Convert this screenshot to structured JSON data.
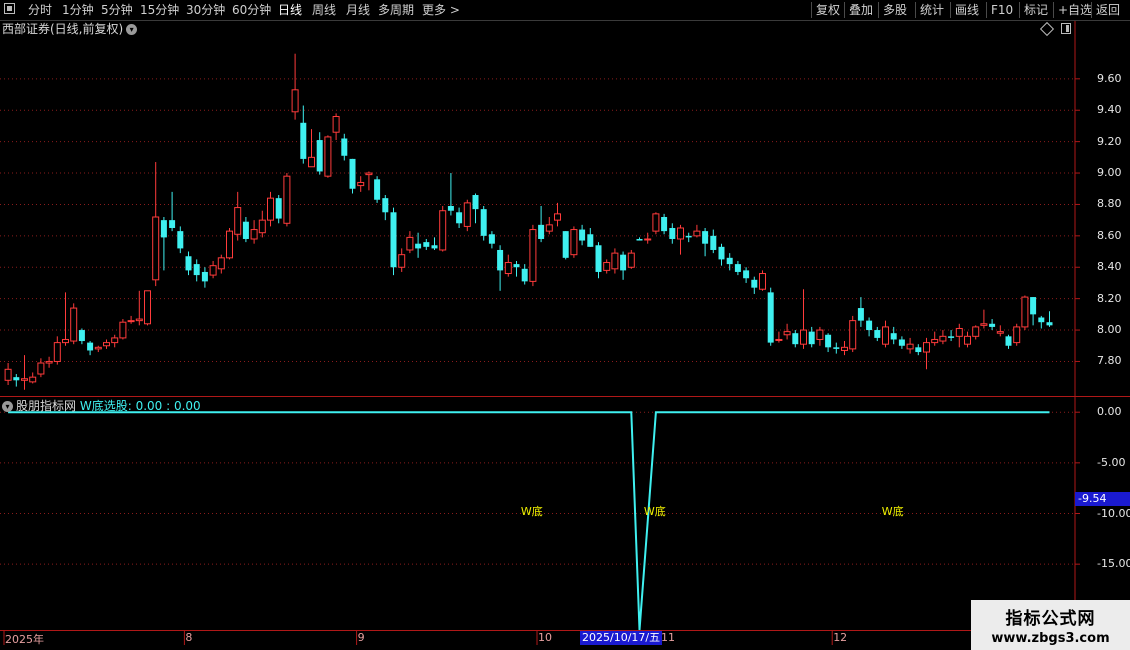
{
  "toolbar": {
    "left_items": [
      "分时",
      "1分钟",
      "5分钟",
      "15分钟",
      "30分钟",
      "60分钟",
      "日线",
      "周线",
      "月线",
      "多周期",
      "更多 >"
    ],
    "active_item": "日线",
    "right_items": [
      "复权",
      "叠加",
      "多股",
      "统计",
      "画线",
      "F10",
      "标记",
      "+自选",
      "返回"
    ]
  },
  "chart_title": "西部证券(日线,前复权)",
  "indicator": {
    "provider": "股朋指标网",
    "label": "W底选股: 0.00 : 0.00",
    "signal_label": "W底"
  },
  "current_date": "2025/10/17/五",
  "watermark": {
    "title": "指标公式网",
    "url": "www.zbgs3.com"
  },
  "colors": {
    "up": "#ff3b3b",
    "down": "#3ff0f0",
    "grid": "#8a1c1c",
    "axis": "#b01818",
    "line": "#3ff0f0",
    "signal": "#f0f000"
  },
  "chart_data": [
    {
      "type": "candlestick",
      "yticks": [
        "9.60",
        "9.40",
        "9.20",
        "9.00",
        "8.80",
        "8.60",
        "8.40",
        "8.20",
        "8.00",
        "7.80"
      ],
      "xticks": [
        "2025年",
        "8",
        "9",
        "10",
        "11",
        "12"
      ],
      "ylim": [
        7.58,
        9.86
      ],
      "candles": [
        [
          7.68,
          7.75,
          7.79,
          7.65
        ],
        [
          7.7,
          7.68,
          7.72,
          7.64
        ],
        [
          7.68,
          7.69,
          7.84,
          7.62
        ],
        [
          7.67,
          7.7,
          7.73,
          7.66
        ],
        [
          7.72,
          7.79,
          7.82,
          7.7
        ],
        [
          7.79,
          7.8,
          7.83,
          7.76
        ],
        [
          7.8,
          7.92,
          7.96,
          7.78
        ],
        [
          7.92,
          7.94,
          8.24,
          7.9
        ],
        [
          7.93,
          8.14,
          8.17,
          7.91
        ],
        [
          8.0,
          7.93,
          8.01,
          7.91
        ],
        [
          7.92,
          7.87,
          7.93,
          7.84
        ],
        [
          7.88,
          7.89,
          7.9,
          7.86
        ],
        [
          7.9,
          7.92,
          7.94,
          7.88
        ],
        [
          7.92,
          7.95,
          7.97,
          7.89
        ],
        [
          7.95,
          8.05,
          8.07,
          7.94
        ],
        [
          8.06,
          8.06,
          8.09,
          8.04
        ],
        [
          8.06,
          8.07,
          8.25,
          8.03
        ],
        [
          8.04,
          8.25,
          8.25,
          8.03
        ],
        [
          8.32,
          8.72,
          9.07,
          8.28
        ],
        [
          8.7,
          8.59,
          8.72,
          8.38
        ],
        [
          8.7,
          8.65,
          8.88,
          8.63
        ],
        [
          8.63,
          8.52,
          8.66,
          8.49
        ],
        [
          8.47,
          8.38,
          8.5,
          8.35
        ],
        [
          8.42,
          8.35,
          8.45,
          8.31
        ],
        [
          8.37,
          8.31,
          8.4,
          8.27
        ],
        [
          8.35,
          8.41,
          8.44,
          8.33
        ],
        [
          8.39,
          8.46,
          8.48,
          8.36
        ],
        [
          8.46,
          8.63,
          8.65,
          8.45
        ],
        [
          8.61,
          8.78,
          8.88,
          8.57
        ],
        [
          8.69,
          8.58,
          8.72,
          8.56
        ],
        [
          8.58,
          8.64,
          8.7,
          8.55
        ],
        [
          8.62,
          8.7,
          8.76,
          8.59
        ],
        [
          8.7,
          8.84,
          8.88,
          8.66
        ],
        [
          8.84,
          8.71,
          8.86,
          8.68
        ],
        [
          8.68,
          8.98,
          9.0,
          8.66
        ],
        [
          9.39,
          9.53,
          9.76,
          9.34
        ],
        [
          9.32,
          9.09,
          9.43,
          9.06
        ],
        [
          9.04,
          9.1,
          9.28,
          9.06
        ],
        [
          9.21,
          9.01,
          9.26,
          8.99
        ],
        [
          8.98,
          9.23,
          9.24,
          8.97
        ],
        [
          9.26,
          9.36,
          9.38,
          9.21
        ],
        [
          9.22,
          9.11,
          9.25,
          9.08
        ],
        [
          9.09,
          8.9,
          9.09,
          8.87
        ],
        [
          8.92,
          8.94,
          8.98,
          8.88
        ],
        [
          8.99,
          9.0,
          9.01,
          8.89
        ],
        [
          8.96,
          8.83,
          8.98,
          8.81
        ],
        [
          8.84,
          8.75,
          8.86,
          8.7
        ],
        [
          8.75,
          8.4,
          8.78,
          8.35
        ],
        [
          8.4,
          8.48,
          8.52,
          8.37
        ],
        [
          8.51,
          8.59,
          8.63,
          8.49
        ],
        [
          8.55,
          8.52,
          8.62,
          8.46
        ],
        [
          8.56,
          8.53,
          8.58,
          8.51
        ],
        [
          8.54,
          8.52,
          8.59,
          8.51
        ],
        [
          8.51,
          8.76,
          8.79,
          8.5
        ],
        [
          8.79,
          8.76,
          9.0,
          8.73
        ],
        [
          8.75,
          8.68,
          8.78,
          8.65
        ],
        [
          8.66,
          8.81,
          8.83,
          8.63
        ],
        [
          8.86,
          8.77,
          8.87,
          8.68
        ],
        [
          8.77,
          8.6,
          8.79,
          8.57
        ],
        [
          8.61,
          8.55,
          8.63,
          8.52
        ],
        [
          8.51,
          8.38,
          8.54,
          8.25
        ],
        [
          8.36,
          8.43,
          8.48,
          8.34
        ],
        [
          8.42,
          8.4,
          8.44,
          8.34
        ],
        [
          8.39,
          8.31,
          8.42,
          8.29
        ],
        [
          8.31,
          8.64,
          8.67,
          8.28
        ],
        [
          8.67,
          8.58,
          8.79,
          8.56
        ],
        [
          8.63,
          8.67,
          8.72,
          8.61
        ],
        [
          8.7,
          8.74,
          8.81,
          8.66
        ],
        [
          8.63,
          8.46,
          8.63,
          8.45
        ],
        [
          8.48,
          8.64,
          8.66,
          8.46
        ],
        [
          8.64,
          8.57,
          8.67,
          8.54
        ],
        [
          8.61,
          8.53,
          8.65,
          8.53
        ],
        [
          8.54,
          8.37,
          8.56,
          8.33
        ],
        [
          8.38,
          8.43,
          8.45,
          8.36
        ],
        [
          8.39,
          8.49,
          8.52,
          8.36
        ],
        [
          8.48,
          8.38,
          8.5,
          8.32
        ],
        [
          8.4,
          8.49,
          8.51,
          8.39
        ],
        [
          8.58,
          8.57,
          8.59,
          8.57
        ],
        [
          8.58,
          8.58,
          8.62,
          8.55
        ],
        [
          8.63,
          8.74,
          8.75,
          8.61
        ],
        [
          8.72,
          8.63,
          8.74,
          8.61
        ],
        [
          8.65,
          8.58,
          8.68,
          8.55
        ],
        [
          8.58,
          8.65,
          8.67,
          8.48
        ],
        [
          8.6,
          8.59,
          8.62,
          8.56
        ],
        [
          8.6,
          8.63,
          8.67,
          8.59
        ],
        [
          8.63,
          8.55,
          8.65,
          8.47
        ],
        [
          8.6,
          8.51,
          8.64,
          8.49
        ],
        [
          8.53,
          8.45,
          8.55,
          8.41
        ],
        [
          8.46,
          8.42,
          8.49,
          8.38
        ],
        [
          8.42,
          8.37,
          8.44,
          8.35
        ],
        [
          8.38,
          8.33,
          8.4,
          8.3
        ],
        [
          8.32,
          8.27,
          8.34,
          8.23
        ],
        [
          8.26,
          8.36,
          8.38,
          8.25
        ],
        [
          8.24,
          7.92,
          8.27,
          7.9
        ],
        [
          7.94,
          7.94,
          7.99,
          7.92
        ],
        [
          7.97,
          7.99,
          8.04,
          7.94
        ],
        [
          7.98,
          7.91,
          8.0,
          7.89
        ],
        [
          7.91,
          8.0,
          8.26,
          7.88
        ],
        [
          7.99,
          7.91,
          8.02,
          7.89
        ],
        [
          7.94,
          8.0,
          8.02,
          7.9
        ],
        [
          7.97,
          7.89,
          7.98,
          7.86
        ],
        [
          7.89,
          7.88,
          7.92,
          7.85
        ],
        [
          7.87,
          7.89,
          7.93,
          7.84
        ],
        [
          7.88,
          8.06,
          8.09,
          7.86
        ],
        [
          8.14,
          8.06,
          8.21,
          8.02
        ],
        [
          8.06,
          8.0,
          8.08,
          7.96
        ],
        [
          8.0,
          7.95,
          8.02,
          7.93
        ],
        [
          7.91,
          8.02,
          8.06,
          7.89
        ],
        [
          7.98,
          7.94,
          8.02,
          7.91
        ],
        [
          7.94,
          7.9,
          7.96,
          7.88
        ],
        [
          7.88,
          7.91,
          7.95,
          7.85
        ],
        [
          7.89,
          7.86,
          7.91,
          7.84
        ],
        [
          7.86,
          7.92,
          7.95,
          7.75
        ],
        [
          7.92,
          7.94,
          7.99,
          7.9
        ],
        [
          7.93,
          7.96,
          8.0,
          7.91
        ],
        [
          7.96,
          7.95,
          8.0,
          7.93
        ],
        [
          7.96,
          8.01,
          8.04,
          7.89
        ],
        [
          7.91,
          7.96,
          7.99,
          7.89
        ],
        [
          7.96,
          8.02,
          8.03,
          7.94
        ],
        [
          8.03,
          8.04,
          8.13,
          8.01
        ],
        [
          8.04,
          8.02,
          8.07,
          8.0
        ],
        [
          7.98,
          7.99,
          8.03,
          7.96
        ],
        [
          7.96,
          7.9,
          7.97,
          7.88
        ],
        [
          7.92,
          8.02,
          8.04,
          7.9
        ],
        [
          8.02,
          8.21,
          8.22,
          8.0
        ],
        [
          8.21,
          8.1,
          8.21,
          8.03
        ],
        [
          8.08,
          8.05,
          8.09,
          8.01
        ],
        [
          8.05,
          8.03,
          8.12,
          8.02
        ]
      ]
    },
    {
      "type": "line",
      "yticks": [
        "0.00",
        "-5.00",
        "-10.00",
        "-15.00"
      ],
      "last_value_label": "-9.54",
      "ylim": [
        -21.5,
        1.5
      ],
      "series": [
        {
          "values": [
            0,
            0,
            0,
            0,
            0,
            0,
            0,
            0,
            0,
            0,
            0,
            0,
            0,
            0,
            0,
            0,
            0,
            0,
            0,
            0,
            0,
            0,
            0,
            0,
            0,
            0,
            0,
            0,
            0,
            0,
            0,
            0,
            0,
            0,
            0,
            0,
            0,
            0,
            0,
            0,
            0,
            0,
            0,
            0,
            0,
            0,
            0,
            0,
            0,
            0,
            0,
            0,
            0,
            0,
            0,
            0,
            0,
            0,
            0,
            0,
            0,
            0,
            0,
            0,
            0,
            0,
            0,
            0,
            0,
            0,
            0,
            0,
            0,
            0,
            0,
            0,
            0,
            0,
            0,
            0,
            0,
            0,
            0,
            0,
            0,
            0,
            0,
            0,
            0,
            0,
            0,
            0,
            0,
            0,
            0,
            0,
            0,
            0,
            0,
            0,
            0,
            0,
            0,
            0,
            0,
            0,
            0,
            0,
            0,
            0,
            0,
            0,
            0,
            0,
            0,
            0,
            0,
            0,
            0,
            0,
            0,
            0,
            0,
            0,
            0,
            0,
            0,
            0
          ]
        }
      ],
      "dips": [
        {
          "at": 77,
          "depth": -21.5
        },
        {
          "at": 78,
          "depth": -10.8
        }
      ],
      "signals": [
        64,
        79,
        108
      ]
    }
  ]
}
